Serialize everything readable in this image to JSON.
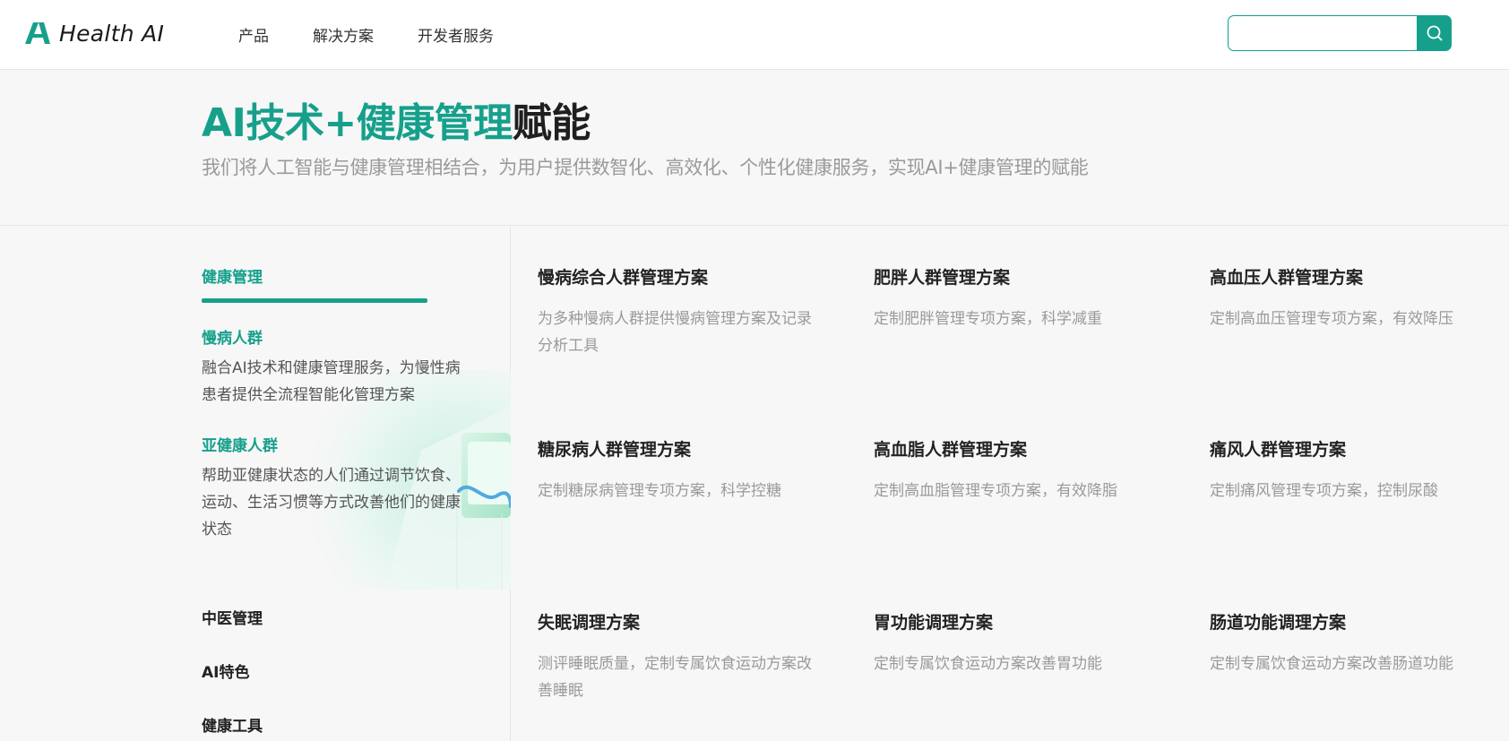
{
  "header": {
    "logo_text": "Health AI",
    "nav": [
      "产品",
      "解决方案",
      "开发者服务"
    ],
    "search": {
      "placeholder": "",
      "value": ""
    },
    "colors": {
      "accent": "#16a08c"
    }
  },
  "hero": {
    "title_accent": "AI技术+健康管理",
    "title_rest": "赋能",
    "subtitle": "我们将人工智能与健康管理相结合，为用户提供数智化、高效化、个性化健康服务，实现AI+健康管理的赋能"
  },
  "sidebar": {
    "active_category": "健康管理",
    "subsections": [
      {
        "title": "慢病人群",
        "desc": "融合AI技术和健康管理服务，为慢性病患者提供全流程智能化管理方案"
      },
      {
        "title": "亚健康人群",
        "desc": "帮助亚健康状态的人们通过调节饮食、运动、生活习惯等方式改善他们的健康状态"
      }
    ],
    "categories": [
      "中医管理",
      "AI特色",
      "健康工具"
    ]
  },
  "solutions": [
    {
      "title": "慢病综合人群管理方案",
      "desc": "为多种慢病人群提供慢病管理方案及记录分析工具"
    },
    {
      "title": "肥胖人群管理方案",
      "desc": "定制肥胖管理专项方案，科学减重"
    },
    {
      "title": "高血压人群管理方案",
      "desc": "定制高血压管理专项方案，有效降压"
    },
    {
      "title": "糖尿病人群管理方案",
      "desc": "定制糖尿病管理专项方案，科学控糖"
    },
    {
      "title": "高血脂人群管理方案",
      "desc": "定制高血脂管理专项方案，有效降脂"
    },
    {
      "title": "痛风人群管理方案",
      "desc": "定制痛风管理专项方案，控制尿酸"
    },
    {
      "title": "失眠调理方案",
      "desc": "测评睡眠质量，定制专属饮食运动方案改善睡眠"
    },
    {
      "title": "胃功能调理方案",
      "desc": "定制专属饮食运动方案改善胃功能"
    },
    {
      "title": "肠道功能调理方案",
      "desc": "定制专属饮食运动方案改善肠道功能"
    }
  ]
}
